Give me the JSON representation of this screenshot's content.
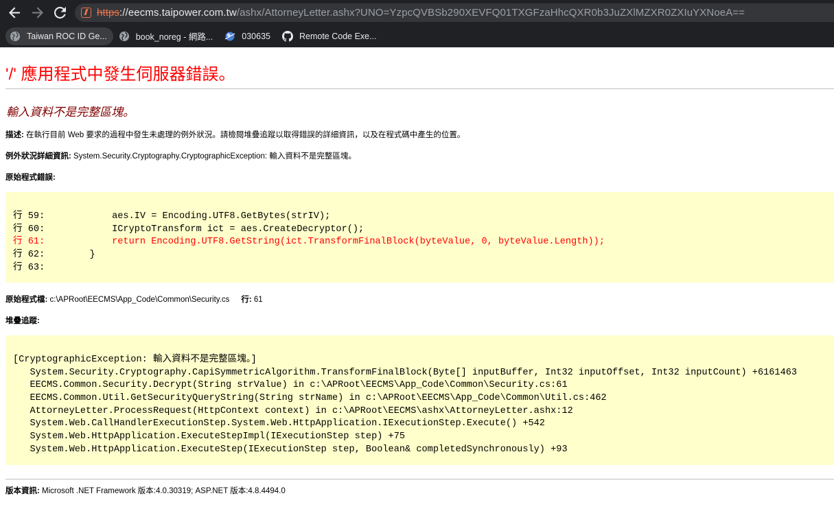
{
  "browser": {
    "url_scheme": "https",
    "url_sep": "://",
    "url_host": "eecms.taipower.com.tw",
    "url_path": "/ashx/AttorneyLetter.ashx?UNO=YzpcQVBSb290XEVFQ01TXGFzaHhcQXR0b3JuZXlMZXR0ZXIuYXNoeA==",
    "bookmarks": [
      {
        "label": "Taiwan ROC ID Ge...",
        "icon": "globe-icon"
      },
      {
        "label": "book_noreg - 網路...",
        "icon": "globe-icon"
      },
      {
        "label": "030635",
        "icon": "app-icon"
      },
      {
        "label": "Remote Code Exe...",
        "icon": "github-icon"
      }
    ]
  },
  "page": {
    "title": "'/' 應用程式中發生伺服器錯誤。",
    "message": "輸入資料不是完整區塊。",
    "desc_label": "描述:",
    "desc_text": " 在執行目前 Web 要求的過程中發生未處理的例外狀況。請檢閱堆疊追蹤以取得錯誤的詳細資訊，以及在程式碼中產生的位置。",
    "exception_label": "例外狀況詳細資訊:",
    "exception_text": " System.Security.Cryptography.CryptographicException: 輸入資料不是完整區塊。",
    "source_error_label": "原始程式錯誤:",
    "source_lines": [
      {
        "text": "行 59:            aes.IV = Encoding.UTF8.GetBytes(strIV);",
        "highlight": false
      },
      {
        "text": "行 60:            ICryptoTransform ict = aes.CreateDecryptor();",
        "highlight": false
      },
      {
        "text": "行 61:            return Encoding.UTF8.GetString(ict.TransformFinalBlock(byteValue, 0, byteValue.Length));",
        "highlight": true
      },
      {
        "text": "行 62:        }",
        "highlight": false
      },
      {
        "text": "行 63:",
        "highlight": false
      }
    ],
    "source_file_label": "原始程式檔:",
    "source_file": " c:\\APRoot\\EECMS\\App_Code\\Common\\Security.cs",
    "line_label": "行:",
    "line_value": " 61",
    "stack_label": "堆疊追蹤:",
    "stack_lines": [
      "[CryptographicException: 輸入資料不是完整區塊。]",
      "   System.Security.Cryptography.CapiSymmetricAlgorithm.TransformFinalBlock(Byte[] inputBuffer, Int32 inputOffset, Int32 inputCount) +6161463",
      "   EECMS.Common.Security.Decrypt(String strValue) in c:\\APRoot\\EECMS\\App_Code\\Common\\Security.cs:61",
      "   EECMS.Common.Util.GetSecurityQueryString(String strName) in c:\\APRoot\\EECMS\\App_Code\\Common\\Util.cs:462",
      "   AttorneyLetter.ProcessRequest(HttpContext context) in c:\\APRoot\\EECMS\\ashx\\AttorneyLetter.ashx:12",
      "   System.Web.CallHandlerExecutionStep.System.Web.HttpApplication.IExecutionStep.Execute() +542",
      "   System.Web.HttpApplication.ExecuteStepImpl(IExecutionStep step) +75",
      "   System.Web.HttpApplication.ExecuteStep(IExecutionStep step, Boolean& completedSynchronously) +93"
    ],
    "version_label": "版本資訊:",
    "version_text": " Microsoft .NET Framework 版本:4.0.30319; ASP.NET 版本:4.8.4494.0"
  },
  "colors": {
    "title": "#ff0000",
    "message": "#800000",
    "code_bg": "#ffffcc",
    "highlight_line": "#ff0000",
    "chrome_bg": "#202124"
  }
}
